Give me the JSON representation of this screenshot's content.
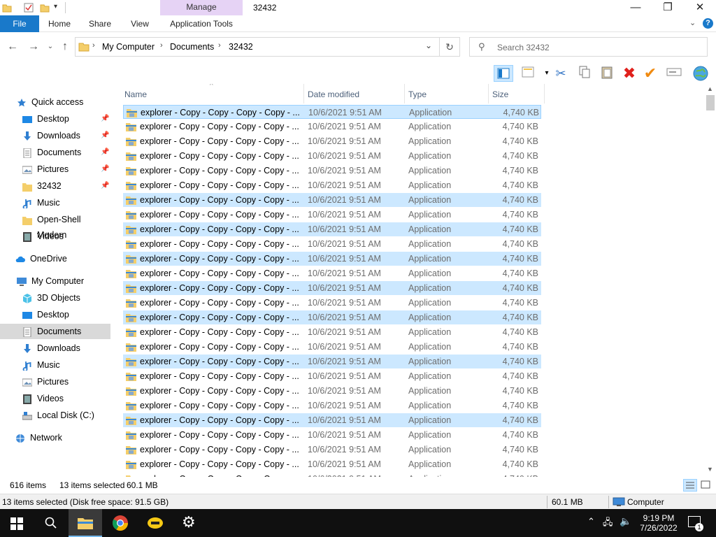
{
  "window": {
    "title": "32432",
    "ribbon_context_label": "Manage",
    "tabs": [
      {
        "label": "File"
      },
      {
        "label": "Home"
      },
      {
        "label": "Share"
      },
      {
        "label": "View"
      },
      {
        "label": "Application Tools"
      }
    ],
    "minimize": "—",
    "maximize": "❐",
    "close": "✕"
  },
  "address": {
    "crumbs": [
      "My Computer",
      "Documents",
      "32432"
    ],
    "search_placeholder": "Search 32432"
  },
  "navpane": {
    "items": [
      {
        "label": "Quick access",
        "icon": "star-icon"
      },
      {
        "label": "Desktop",
        "icon": "desktop-icon"
      },
      {
        "label": "Downloads",
        "icon": "download-icon"
      },
      {
        "label": "Documents",
        "icon": "documents-icon"
      },
      {
        "label": "Pictures",
        "icon": "pictures-icon"
      },
      {
        "label": "32432",
        "icon": "folder-icon"
      },
      {
        "label": "Music",
        "icon": "music-icon"
      },
      {
        "label": "Open-Shell Modern",
        "icon": "folder-icon"
      },
      {
        "label": "Videos",
        "icon": "videos-icon"
      },
      {
        "label": "OneDrive",
        "icon": "cloud-icon"
      },
      {
        "label": "My Computer",
        "icon": "computer-icon"
      },
      {
        "label": "3D Objects",
        "icon": "cube-icon"
      },
      {
        "label": "Desktop",
        "icon": "desktop-icon"
      },
      {
        "label": "Documents",
        "icon": "documents-icon"
      },
      {
        "label": "Downloads",
        "icon": "download-icon"
      },
      {
        "label": "Music",
        "icon": "music-icon"
      },
      {
        "label": "Pictures",
        "icon": "pictures-icon"
      },
      {
        "label": "Videos",
        "icon": "videos-icon"
      },
      {
        "label": "Local Disk (C:)",
        "icon": "drive-icon"
      },
      {
        "label": "Network",
        "icon": "network-icon"
      }
    ]
  },
  "filelist": {
    "columns": [
      "Name",
      "Date modified",
      "Type",
      "Size"
    ],
    "row_name": "explorer - Copy - Copy - Copy - Copy - ...",
    "row_date": "10/6/2021 9:51 AM",
    "row_type": "Application",
    "row_size": "4,740 KB",
    "selected_rows": [
      0,
      6,
      8,
      10,
      12,
      14,
      17,
      21
    ],
    "light_rows": [
      0,
      1,
      2,
      3,
      4,
      5,
      6,
      7,
      8,
      9,
      10,
      11,
      12,
      13,
      14,
      15,
      16,
      17,
      18,
      19,
      20,
      21,
      22,
      23,
      24
    ]
  },
  "status": {
    "item_count": "616 items",
    "selected": "13 items selected",
    "selected_size": "60.1 MB",
    "bar2_left": "13 items selected (Disk free space: 91.5 GB)",
    "bar2_size": "60.1 MB",
    "bar2_location": "Computer"
  },
  "taskbar": {
    "time": "9:19 PM",
    "date": "7/26/2022",
    "notification_count": "1"
  }
}
